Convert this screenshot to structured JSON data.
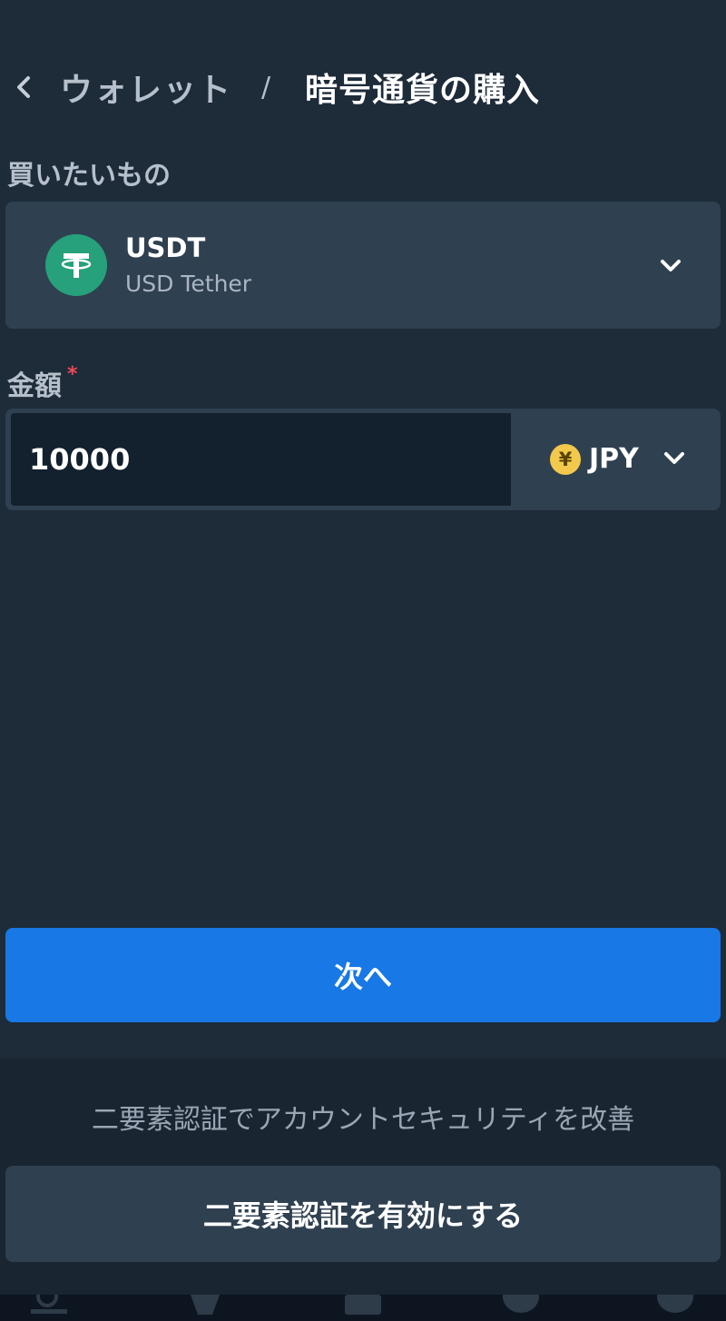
{
  "header": {
    "back_icon": "chevron-left-icon",
    "parent": "ウォレット",
    "separator": "/",
    "current": "暗号通貨の購入"
  },
  "buy": {
    "label": "買いたいもの",
    "asset": {
      "symbol": "USDT",
      "name": "USD Tether",
      "icon": "tether-icon",
      "color": "#26a17b"
    }
  },
  "amount": {
    "label": "金額",
    "required_mark": "*",
    "value": "10000",
    "currency": {
      "code": "JPY",
      "symbol": "¥",
      "icon": "yen-coin-icon"
    }
  },
  "actions": {
    "next_label": "次へ",
    "next_color": "#1778e6"
  },
  "footer": {
    "prompt": "二要素認証でアカウントセキュリティを改善",
    "enable_2fa_label": "二要素認証を有効にする"
  },
  "tabbar": {
    "icons": [
      "markets-icon",
      "trade-icon",
      "orders-icon",
      "wallet-icon",
      "chat-icon"
    ]
  }
}
